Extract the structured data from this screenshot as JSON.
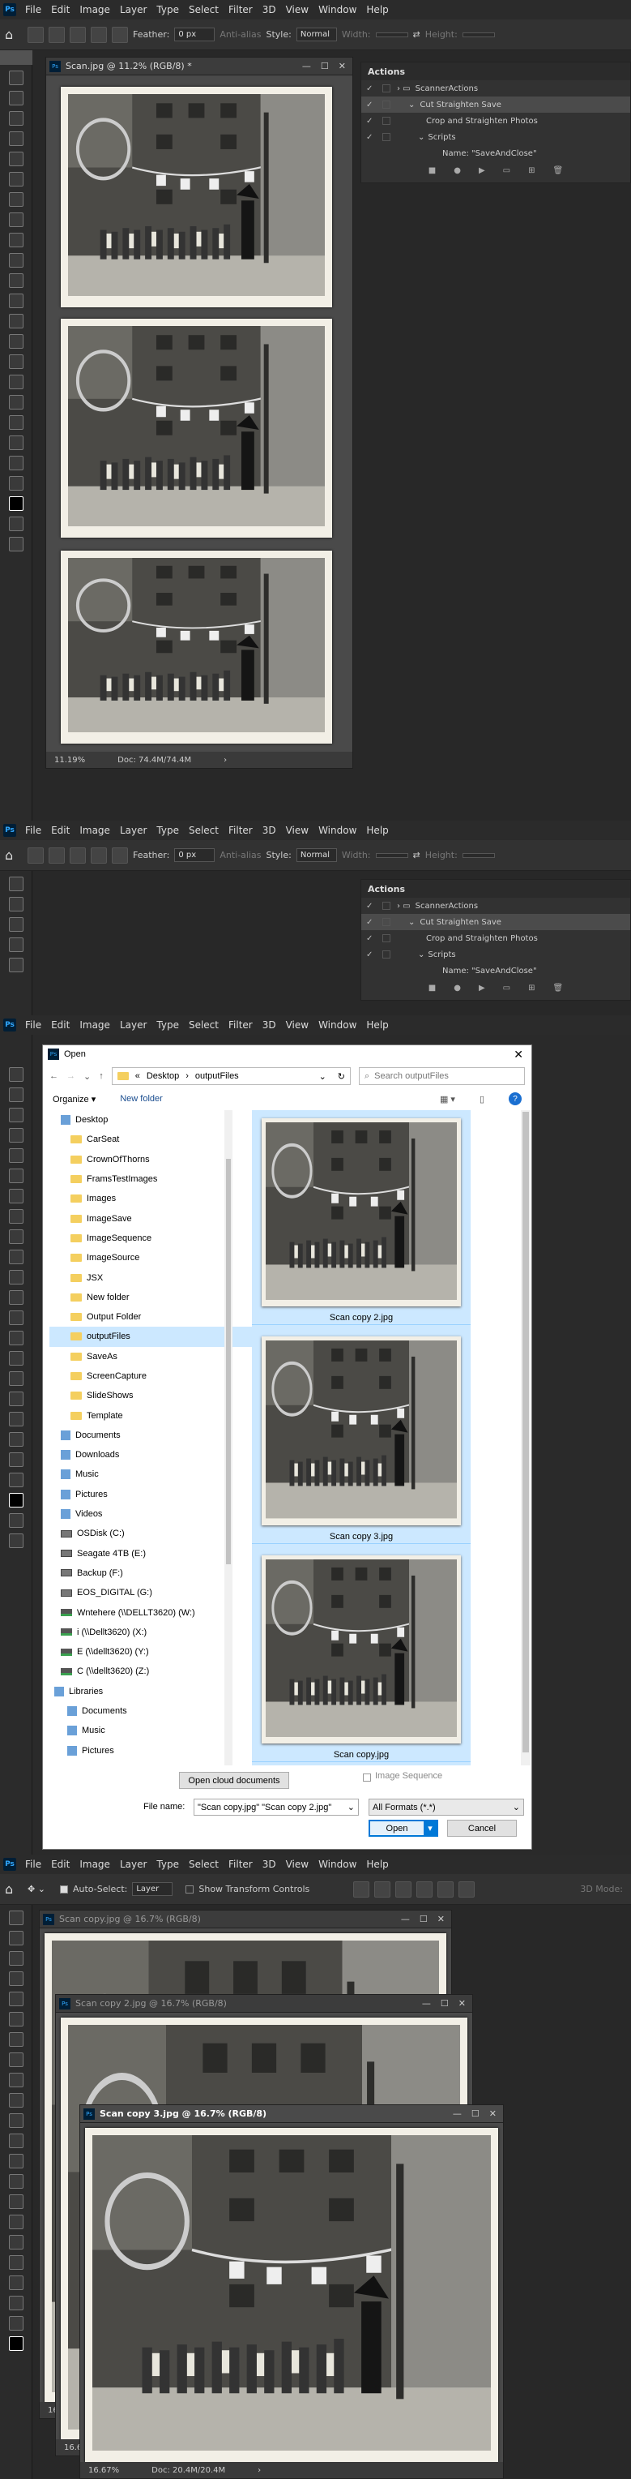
{
  "ps": {
    "logo": "Ps",
    "menu": [
      "File",
      "Edit",
      "Image",
      "Layer",
      "Type",
      "Select",
      "Filter",
      "3D",
      "View",
      "Window",
      "Help"
    ],
    "options": {
      "feather_label": "Feather:",
      "feather_value": "0 px",
      "antialias": "Anti-alias",
      "style_label": "Style:",
      "style_value": "Normal",
      "width_label": "Width:",
      "height_label": "Height:"
    },
    "move_options": {
      "auto_select": "Auto-Select:",
      "layer": "Layer",
      "transform": "Show Transform Controls",
      "mode3d": "3D Mode:"
    }
  },
  "s1": {
    "doc_title": "Scan.jpg @ 11.2% (RGB/8) *",
    "zoom": "11.19%",
    "doc_size": "Doc: 74.4M/74.4M"
  },
  "actions": {
    "title": "Actions",
    "rows": [
      "ScannerActions",
      "Cut Straighten Save",
      "Crop and Straighten Photos",
      "Scripts",
      "Name: \"SaveAndClose\""
    ]
  },
  "dialog": {
    "title": "Open",
    "path": [
      "Desktop",
      "outputFiles"
    ],
    "search": "Search outputFiles",
    "organize": "Organize ▾",
    "new_folder": "New folder",
    "tree": [
      {
        "label": "Desktop",
        "icon": "folder-blue"
      },
      {
        "label": "CarSeat",
        "icon": "folder"
      },
      {
        "label": "CrownOfThorns",
        "icon": "folder"
      },
      {
        "label": "FramsTestImages",
        "icon": "folder"
      },
      {
        "label": "Images",
        "icon": "folder"
      },
      {
        "label": "ImageSave",
        "icon": "folder"
      },
      {
        "label": "ImageSequence",
        "icon": "folder"
      },
      {
        "label": "ImageSource",
        "icon": "folder"
      },
      {
        "label": "JSX",
        "icon": "folder"
      },
      {
        "label": "New folder",
        "icon": "folder"
      },
      {
        "label": "Output Folder",
        "icon": "folder"
      },
      {
        "label": "outputFiles",
        "icon": "folder"
      },
      {
        "label": "SaveAs",
        "icon": "folder"
      },
      {
        "label": "ScreenCapture",
        "icon": "folder"
      },
      {
        "label": "SlideShows",
        "icon": "folder"
      },
      {
        "label": "Template",
        "icon": "folder"
      },
      {
        "label": "Documents",
        "icon": "library"
      },
      {
        "label": "Downloads",
        "icon": "library"
      },
      {
        "label": "Music",
        "icon": "library"
      },
      {
        "label": "Pictures",
        "icon": "library"
      },
      {
        "label": "Videos",
        "icon": "library"
      },
      {
        "label": "OSDisk (C:)",
        "icon": "drive"
      },
      {
        "label": "Seagate 4TB (E:)",
        "icon": "drive"
      },
      {
        "label": "Backup (F:)",
        "icon": "drive"
      },
      {
        "label": "EOS_DIGITAL (G:)",
        "icon": "drive"
      },
      {
        "label": "Wntehere (\\\\DELLT3620) (W:)",
        "icon": "netdrive"
      },
      {
        "label": "i (\\\\Dellt3620) (X:)",
        "icon": "netdrive"
      },
      {
        "label": "E (\\\\dellt3620) (Y:)",
        "icon": "netdrive"
      },
      {
        "label": "C (\\\\dellt3620) (Z:)",
        "icon": "netdrive"
      },
      {
        "label": "Libraries",
        "icon": "library"
      },
      {
        "label": "Documents",
        "icon": "library"
      },
      {
        "label": "Music",
        "icon": "library"
      },
      {
        "label": "Pictures",
        "icon": "library"
      }
    ],
    "files": [
      "Scan copy 2.jpg",
      "Scan copy 3.jpg",
      "Scan copy.jpg"
    ],
    "cloud_button": "Open cloud documents",
    "image_sequence": "Image Sequence",
    "filename_label": "File name:",
    "filename_value": "\"Scan copy.jpg\" \"Scan copy 2.jpg\"",
    "format": "All Formats (*.*)",
    "open": "Open",
    "cancel": "Cancel"
  },
  "s4": {
    "doc1": "Scan copy.jpg @ 16.7% (RGB/8)",
    "doc2": "Scan copy 2.jpg @ 16.7% (RGB/8)",
    "doc3": "Scan copy 3.jpg @ 16.7% (RGB/8)",
    "zoom_a": "16.",
    "zoom_b": "16.6",
    "zoom": "16.67%",
    "doc_size": "Doc: 20.4M/20.4M"
  }
}
